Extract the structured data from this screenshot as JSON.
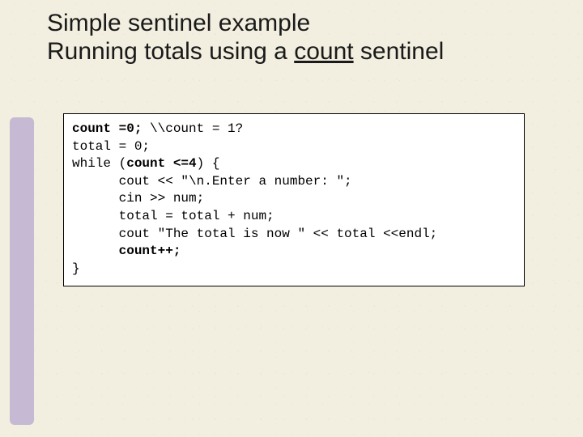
{
  "title": {
    "line1": "Simple sentinel example",
    "line2_pre": "Running totals using a ",
    "line2_count": "count",
    "line2_post": " sentinel"
  },
  "code": {
    "l1_a": "count =0;",
    "l1_b": " \\\\count = 1?",
    "l2": "total = 0;",
    "l3_a": "while (",
    "l3_b": "count <=4",
    "l3_c": ") {",
    "l4": "      cout << \"\\n.Enter a number: \";",
    "l5": "      cin >> num;",
    "l6": "      total = total + num;",
    "l7": "      cout \"The total is now \" << total <<endl;",
    "l8_a": "      ",
    "l8_b": "count++;",
    "l9": "}"
  }
}
